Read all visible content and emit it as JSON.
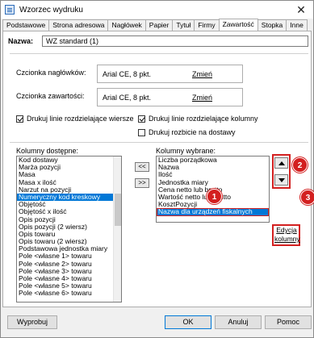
{
  "window": {
    "title": "Wzorzec wydruku",
    "close_glyph": "✕"
  },
  "tabs": [
    "Podstawowe",
    "Strona adresowa",
    "Nagłówek",
    "Papier",
    "Tytuł",
    "Firmy",
    "Zawartość",
    "Stopka",
    "Inne"
  ],
  "active_tab": "Zawartość",
  "name_label": "Nazwa:",
  "name_value": "WZ standard (1)",
  "header_font": {
    "label": "Czcionka nagłówków:",
    "value": "Arial CE, 8 pkt.",
    "change": "Zmień"
  },
  "content_font": {
    "label": "Czcionka zawartości:",
    "value": "Arial CE, 8 pkt.",
    "change": "Zmień"
  },
  "checkboxes": {
    "row_lines": {
      "label": "Drukuj linie rozdzielające wiersze",
      "checked": true
    },
    "column_lines": {
      "label": "Drukuj linie rozdzielające kolumny",
      "checked": true
    },
    "deliveries": {
      "label": "Drukuj rozbicie na dostawy",
      "checked": false
    }
  },
  "available": {
    "label": "Kolumny dostępne:",
    "items": [
      "Kod dostawy",
      "Marża pozycji",
      "Masa",
      "Masa x ilość",
      "Narzut na pozycji",
      "Numeryczny kod kreskowy",
      "Objętość",
      "Objętość x ilość",
      "Opis pozycji",
      "Opis pozycji (2 wiersz)",
      "Opis towaru",
      "Opis towaru (2 wiersz)",
      "Podstawowa jednostka miary",
      "Pole <własne 1> towaru",
      "Pole <własne 2> towaru",
      "Pole <własne 3> towaru",
      "Pole <własne 4> towaru",
      "Pole <własne 5> towaru",
      "Pole <własne 6> towaru"
    ],
    "selected": "Numeryczny kod kreskowy"
  },
  "move_buttons": {
    "remove": "<<",
    "add": ">>"
  },
  "chosen": {
    "label": "Kolumny wybrane:",
    "items": [
      "Liczba porządkowa",
      "Nazwa",
      "Ilość",
      "Jednostka miary",
      "Cena netto lub brutto",
      "Wartość netto lub brutto",
      "KosztPozycji",
      "Nazwa dla urządzeń fiskalnych"
    ],
    "selected": "Nazwa dla urządzeń fiskalnych"
  },
  "edit_column": {
    "line1": "Edycja",
    "line2": "kolumny"
  },
  "callouts": [
    "1",
    "2",
    "3"
  ],
  "footer": {
    "restore": "Wyprobuj",
    "ok": "OK",
    "cancel": "Anuluj",
    "help": "Pomoc"
  },
  "colors": {
    "selection": "#0078d7",
    "annotation_red": "#d32020"
  }
}
